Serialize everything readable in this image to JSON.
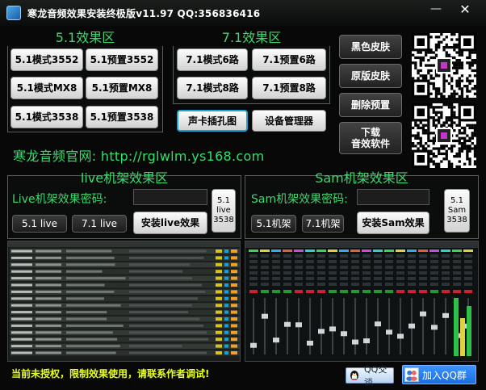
{
  "window": {
    "title": "寒龙音频效果安装终极版v11.97 QQ:356836416",
    "minimize_glyph": "—",
    "close_glyph": "✕"
  },
  "group51": {
    "title": "5.1效果区",
    "buttons": [
      "5.1模式3552",
      "5.1预置3552",
      "5.1模式MX8",
      "5.1预置MX8",
      "5.1模式3538",
      "5.1预置3538"
    ]
  },
  "group71": {
    "title": "7.1效果区",
    "buttons": [
      "7.1模式6路",
      "7.1预置6路",
      "7.1模式8路",
      "7.1预置8路"
    ]
  },
  "tools": {
    "jack_diagram": "声卡插孔图",
    "device_manager": "设备管理器"
  },
  "side": {
    "black_skin": "黑色皮肤",
    "original_skin": "原版皮肤",
    "delete_preset": "删除预置",
    "download_line1": "下载",
    "download_line2": "音效软件"
  },
  "website": "寒龙音频官网: http://rglwlm.ys168.com",
  "live": {
    "title": "live机架效果区",
    "password_label": "Live机架效果密码:",
    "password_value": "",
    "btn_51": "5.1 live",
    "btn_71": "7.1 live",
    "install": "安装live效果",
    "side_line1": "5.1",
    "side_line2": "live",
    "side_line3": "3538"
  },
  "sam": {
    "title": "Sam机架效果区",
    "password_label": "Sam机架效果密码:",
    "password_value": "",
    "btn_51": "5.1机架",
    "btn_71": "7.1机架",
    "install": "安装Sam效果",
    "side_line1": "5.1",
    "side_line2": "Sam",
    "side_line3": "3538"
  },
  "status": "当前未授权，限制效果使用，请联系作者调试!",
  "qq_chat": "QQ交谈",
  "qq_group": "加入QQ群",
  "colors": {
    "group_title": "#3fd76e",
    "website": "#2fe06a",
    "status": "#e8ff1c",
    "selected_border": "#1aa7d6"
  }
}
